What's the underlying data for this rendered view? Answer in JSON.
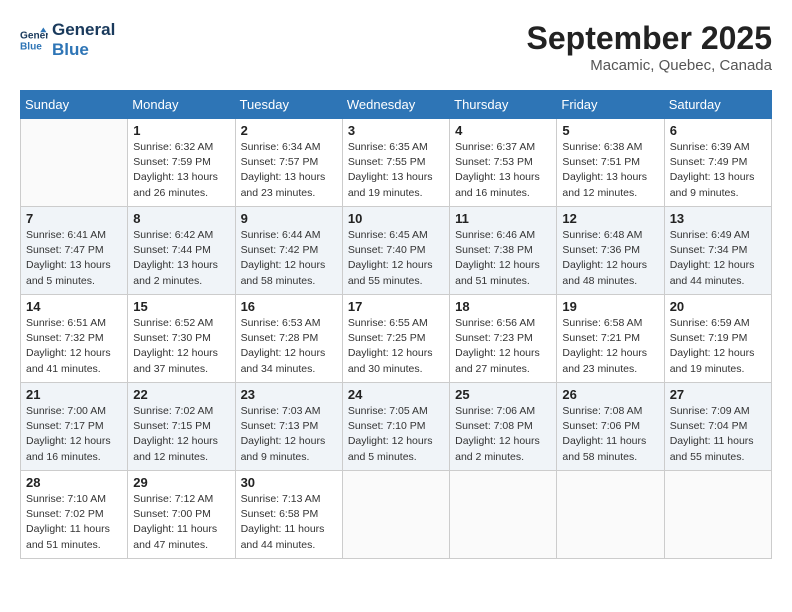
{
  "header": {
    "logo_line1": "General",
    "logo_line2": "Blue",
    "month": "September 2025",
    "location": "Macamic, Quebec, Canada"
  },
  "days_of_week": [
    "Sunday",
    "Monday",
    "Tuesday",
    "Wednesday",
    "Thursday",
    "Friday",
    "Saturday"
  ],
  "weeks": [
    [
      {
        "day": "",
        "info": ""
      },
      {
        "day": "1",
        "info": "Sunrise: 6:32 AM\nSunset: 7:59 PM\nDaylight: 13 hours\nand 26 minutes."
      },
      {
        "day": "2",
        "info": "Sunrise: 6:34 AM\nSunset: 7:57 PM\nDaylight: 13 hours\nand 23 minutes."
      },
      {
        "day": "3",
        "info": "Sunrise: 6:35 AM\nSunset: 7:55 PM\nDaylight: 13 hours\nand 19 minutes."
      },
      {
        "day": "4",
        "info": "Sunrise: 6:37 AM\nSunset: 7:53 PM\nDaylight: 13 hours\nand 16 minutes."
      },
      {
        "day": "5",
        "info": "Sunrise: 6:38 AM\nSunset: 7:51 PM\nDaylight: 13 hours\nand 12 minutes."
      },
      {
        "day": "6",
        "info": "Sunrise: 6:39 AM\nSunset: 7:49 PM\nDaylight: 13 hours\nand 9 minutes."
      }
    ],
    [
      {
        "day": "7",
        "info": "Sunrise: 6:41 AM\nSunset: 7:47 PM\nDaylight: 13 hours\nand 5 minutes."
      },
      {
        "day": "8",
        "info": "Sunrise: 6:42 AM\nSunset: 7:44 PM\nDaylight: 13 hours\nand 2 minutes."
      },
      {
        "day": "9",
        "info": "Sunrise: 6:44 AM\nSunset: 7:42 PM\nDaylight: 12 hours\nand 58 minutes."
      },
      {
        "day": "10",
        "info": "Sunrise: 6:45 AM\nSunset: 7:40 PM\nDaylight: 12 hours\nand 55 minutes."
      },
      {
        "day": "11",
        "info": "Sunrise: 6:46 AM\nSunset: 7:38 PM\nDaylight: 12 hours\nand 51 minutes."
      },
      {
        "day": "12",
        "info": "Sunrise: 6:48 AM\nSunset: 7:36 PM\nDaylight: 12 hours\nand 48 minutes."
      },
      {
        "day": "13",
        "info": "Sunrise: 6:49 AM\nSunset: 7:34 PM\nDaylight: 12 hours\nand 44 minutes."
      }
    ],
    [
      {
        "day": "14",
        "info": "Sunrise: 6:51 AM\nSunset: 7:32 PM\nDaylight: 12 hours\nand 41 minutes."
      },
      {
        "day": "15",
        "info": "Sunrise: 6:52 AM\nSunset: 7:30 PM\nDaylight: 12 hours\nand 37 minutes."
      },
      {
        "day": "16",
        "info": "Sunrise: 6:53 AM\nSunset: 7:28 PM\nDaylight: 12 hours\nand 34 minutes."
      },
      {
        "day": "17",
        "info": "Sunrise: 6:55 AM\nSunset: 7:25 PM\nDaylight: 12 hours\nand 30 minutes."
      },
      {
        "day": "18",
        "info": "Sunrise: 6:56 AM\nSunset: 7:23 PM\nDaylight: 12 hours\nand 27 minutes."
      },
      {
        "day": "19",
        "info": "Sunrise: 6:58 AM\nSunset: 7:21 PM\nDaylight: 12 hours\nand 23 minutes."
      },
      {
        "day": "20",
        "info": "Sunrise: 6:59 AM\nSunset: 7:19 PM\nDaylight: 12 hours\nand 19 minutes."
      }
    ],
    [
      {
        "day": "21",
        "info": "Sunrise: 7:00 AM\nSunset: 7:17 PM\nDaylight: 12 hours\nand 16 minutes."
      },
      {
        "day": "22",
        "info": "Sunrise: 7:02 AM\nSunset: 7:15 PM\nDaylight: 12 hours\nand 12 minutes."
      },
      {
        "day": "23",
        "info": "Sunrise: 7:03 AM\nSunset: 7:13 PM\nDaylight: 12 hours\nand 9 minutes."
      },
      {
        "day": "24",
        "info": "Sunrise: 7:05 AM\nSunset: 7:10 PM\nDaylight: 12 hours\nand 5 minutes."
      },
      {
        "day": "25",
        "info": "Sunrise: 7:06 AM\nSunset: 7:08 PM\nDaylight: 12 hours\nand 2 minutes."
      },
      {
        "day": "26",
        "info": "Sunrise: 7:08 AM\nSunset: 7:06 PM\nDaylight: 11 hours\nand 58 minutes."
      },
      {
        "day": "27",
        "info": "Sunrise: 7:09 AM\nSunset: 7:04 PM\nDaylight: 11 hours\nand 55 minutes."
      }
    ],
    [
      {
        "day": "28",
        "info": "Sunrise: 7:10 AM\nSunset: 7:02 PM\nDaylight: 11 hours\nand 51 minutes."
      },
      {
        "day": "29",
        "info": "Sunrise: 7:12 AM\nSunset: 7:00 PM\nDaylight: 11 hours\nand 47 minutes."
      },
      {
        "day": "30",
        "info": "Sunrise: 7:13 AM\nSunset: 6:58 PM\nDaylight: 11 hours\nand 44 minutes."
      },
      {
        "day": "",
        "info": ""
      },
      {
        "day": "",
        "info": ""
      },
      {
        "day": "",
        "info": ""
      },
      {
        "day": "",
        "info": ""
      }
    ]
  ]
}
